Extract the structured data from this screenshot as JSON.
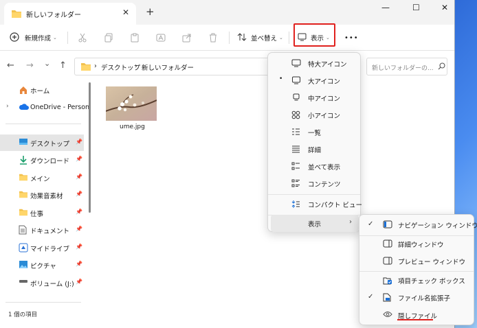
{
  "tab": {
    "title": "新しいフォルダー",
    "close": "✕",
    "new_tab": "+"
  },
  "window_controls": {
    "minimize": "—",
    "maximize": "☐",
    "close": "✕"
  },
  "toolbar": {
    "new_label": "新規作成",
    "sort_label": "並べ替え",
    "view_label": "表示",
    "more": "•••",
    "highlight_color": "#e0201d"
  },
  "nav": {
    "back": "←",
    "forward": "→",
    "recent": "⌄",
    "up": "↑",
    "breadcrumb": [
      "デスクトップ",
      "新しいフォルダー"
    ],
    "separator": "›",
    "search_placeholder": "新しいフォルダーの..."
  },
  "sidebar": {
    "items": [
      {
        "label": "ホーム",
        "icon": "home-icon"
      },
      {
        "label": "OneDrive - Person",
        "icon": "cloud-icon"
      },
      {
        "label": "デスクトップ",
        "icon": "desktop-icon",
        "selected": true,
        "pinned": true
      },
      {
        "label": "ダウンロード",
        "icon": "download-icon",
        "pinned": true
      },
      {
        "label": "メイン",
        "icon": "folder-icon",
        "pinned": true
      },
      {
        "label": "効果音素材",
        "icon": "folder-icon",
        "pinned": true
      },
      {
        "label": "仕事",
        "icon": "folder-icon",
        "pinned": true
      },
      {
        "label": "ドキュメント",
        "icon": "document-icon",
        "pinned": true
      },
      {
        "label": "マイドライブ",
        "icon": "drive-icon",
        "pinned": true
      },
      {
        "label": "ピクチャ",
        "icon": "pictures-icon",
        "pinned": true
      },
      {
        "label": "ボリューム (J:)",
        "icon": "volume-icon",
        "pinned": true
      }
    ]
  },
  "files": [
    {
      "name": "ume.jpg",
      "icon": "image-thumbnail"
    }
  ],
  "status": {
    "count_text": "1 個の項目"
  },
  "view_menu": {
    "items": [
      {
        "label": "特大アイコン",
        "icon": "monitor-icon"
      },
      {
        "label": "大アイコン",
        "icon": "monitor-icon",
        "selected": true
      },
      {
        "label": "中アイコン",
        "icon": "monitor-small-icon"
      },
      {
        "label": "小アイコン",
        "icon": "grid-icon"
      },
      {
        "label": "一覧",
        "icon": "list-icon"
      },
      {
        "label": "詳細",
        "icon": "details-icon"
      },
      {
        "label": "並べて表示",
        "icon": "tiles-icon"
      },
      {
        "label": "コンテンツ",
        "icon": "content-icon"
      },
      {
        "label": "コンパクト ビュー",
        "icon": "compact-icon"
      },
      {
        "label": "表示",
        "icon": "",
        "submenu": true
      }
    ],
    "bullet": "•",
    "sub_arrow": "›"
  },
  "show_submenu": {
    "items": [
      {
        "label": "ナビゲーション ウィンドウ",
        "icon": "pane-left-icon",
        "checked": true
      },
      {
        "label": "詳細ウィンドウ",
        "icon": "pane-right-icon",
        "checked": false
      },
      {
        "label": "プレビュー ウィンドウ",
        "icon": "pane-right-icon",
        "checked": false
      },
      {
        "label": "項目チェック ボックス",
        "icon": "checkbox-icon",
        "checked": false
      },
      {
        "label": "ファイル名拡張子",
        "icon": "file-ext-icon",
        "checked": true
      },
      {
        "label": "隠しファイル",
        "icon": "eye-icon",
        "checked": false
      }
    ],
    "check": "✓"
  }
}
